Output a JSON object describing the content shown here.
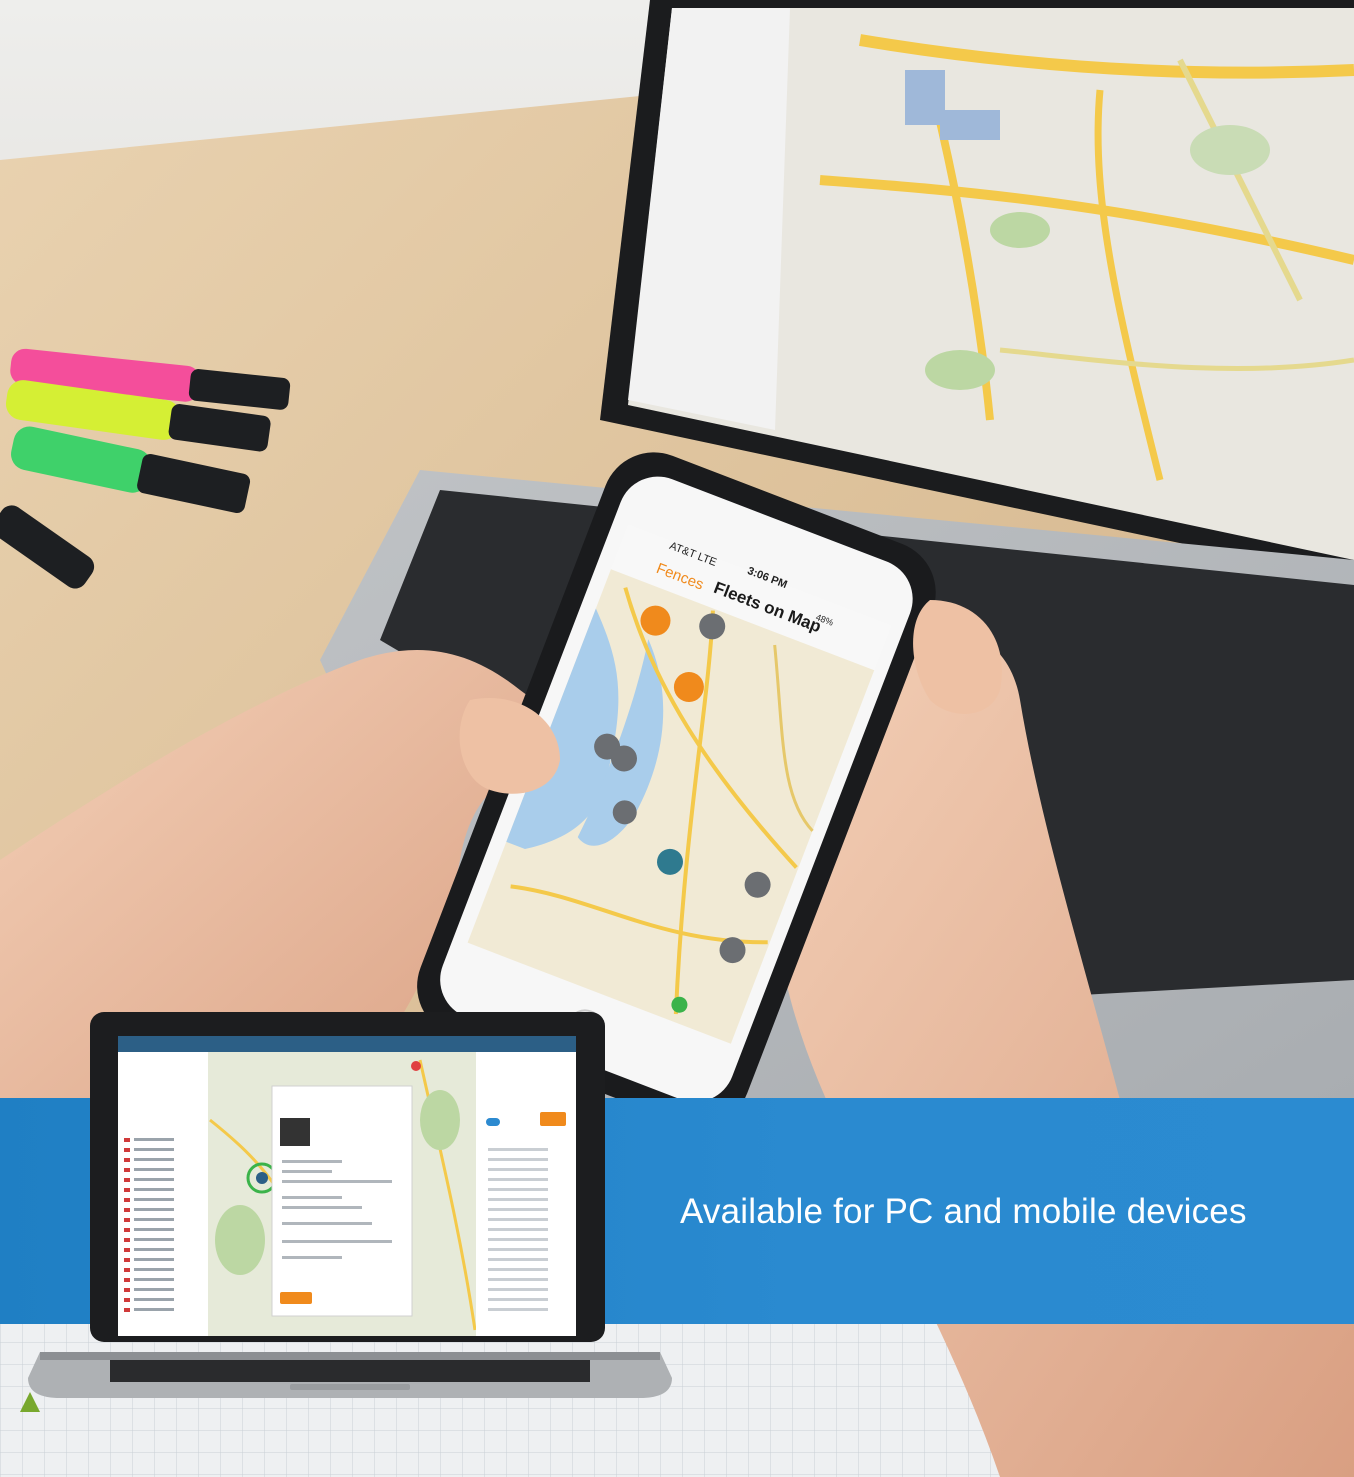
{
  "banner": {
    "text": "Available for PC and mobile devices"
  },
  "phone": {
    "carrier": "AT&T LTE",
    "time": "3:06 PM",
    "back_label": "Fences",
    "title": "Fleets on Map",
    "battery": "48%"
  },
  "colors": {
    "banner_blue": "#2384c8",
    "accent_orange": "#f08a1c",
    "map_water": "#a9cdeb",
    "map_road": "#f4c94a"
  }
}
